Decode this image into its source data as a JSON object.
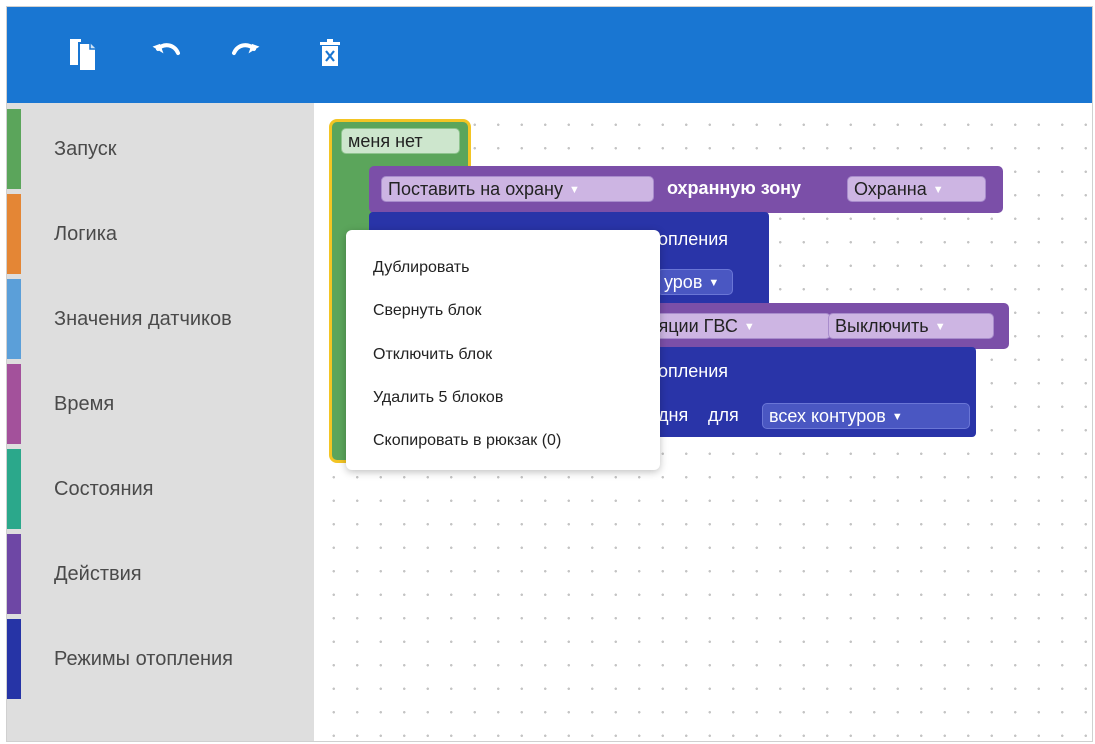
{
  "colors": {
    "toolbar": "#1976d2",
    "sidebar_bg": "#dedede",
    "green_block": "#5ba55b",
    "purple_block": "#7b4fa8",
    "blue_block": "#2934a8",
    "selection": "#f3c524"
  },
  "toolbar": {
    "icons": [
      "copy-icon",
      "undo-icon",
      "redo-icon",
      "trash-icon"
    ]
  },
  "sidebar": {
    "categories": [
      {
        "label": "Запуск",
        "color": "#5ba55b"
      },
      {
        "label": "Логика",
        "color": "#e48635"
      },
      {
        "label": "Значения датчиков",
        "color": "#5b9fd9"
      },
      {
        "label": "Время",
        "color": "#a3519b"
      },
      {
        "label": "Состояния",
        "color": "#2ba88b"
      },
      {
        "label": "Действия",
        "color": "#6e47a5"
      },
      {
        "label": "Режимы отопления",
        "color": "#2634a6"
      }
    ]
  },
  "workspace": {
    "green_block": {
      "dropdown": "меня нет"
    },
    "purple_block_1": {
      "action": "Поставить на охрану",
      "text": "охранную зону",
      "zone": "Охранна"
    },
    "blue_block_1": {
      "partial_text": "опления",
      "partial_dropdown": "уров"
    },
    "purple_block_2": {
      "partial_dropdown": "ляции ГВС",
      "state": "Выключить"
    },
    "blue_block_2": {
      "partial_text": "опления",
      "partial_text_2": "дня",
      "text_for": "для",
      "contours": "всех контуров"
    }
  },
  "context_menu": {
    "items": [
      "Дублировать",
      "Свернуть блок",
      "Отключить блок",
      "Удалить 5 блоков",
      "Скопировать в рюкзак (0)"
    ]
  }
}
